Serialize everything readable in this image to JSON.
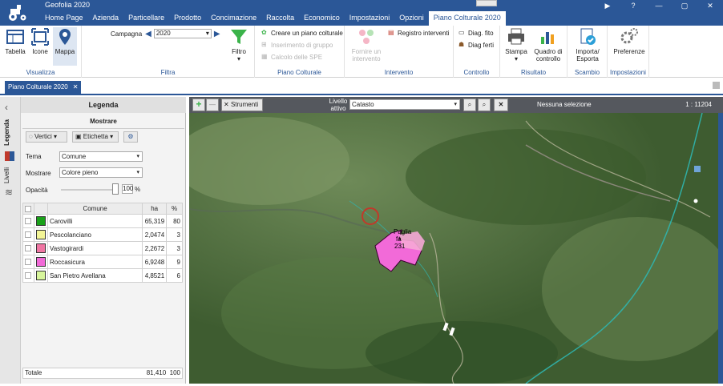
{
  "app": {
    "title": "Geofolia 2020"
  },
  "window": {
    "help": "?",
    "minimize": "—",
    "maximize": "▢",
    "close": "✕",
    "play": "▶"
  },
  "menu": [
    "Home Page",
    "Azienda",
    "Particellare",
    "Prodotto",
    "Concimazione",
    "Raccolta",
    "Economico",
    "Impostazioni",
    "Opzioni",
    "Piano Colturale 2020"
  ],
  "ribbon": {
    "visualizza": {
      "label": "Visualizza",
      "tabella": "Tabella",
      "icone": "Icone",
      "mappa": "Mappa"
    },
    "filtra": {
      "label": "Filtra",
      "campagna_label": "Campagna",
      "campagna_value": "2020",
      "filtro": "Filtro"
    },
    "piano": {
      "label": "Piano Colturale",
      "crea": "Creare un piano colturale",
      "inserimento": "Inserimento di gruppo",
      "calcolo": "Calcolo delle SPE"
    },
    "intervento": {
      "label": "Intervento",
      "fornire": "Fornire un intervento",
      "registro": "Registro interventi"
    },
    "controllo": {
      "label": "Controllo",
      "diag_fito": "Diag. fito",
      "diag_ferti": "Diag ferti"
    },
    "risultato": {
      "label": "Risultato",
      "stampa": "Stampa",
      "quadro": "Quadro di controllo"
    },
    "scambio": {
      "label": "Scambio",
      "importa": "Importa/ Esporta"
    },
    "impostazioni": {
      "label": "Impostazioni",
      "preferenze": "Preferenze"
    }
  },
  "doctab": {
    "label": "Piano Colturale 2020",
    "close": "✕"
  },
  "sidetabs": {
    "legenda": "Legenda",
    "livelli": "Livelli"
  },
  "legend": {
    "title": "Legenda",
    "mostrare_header": "Mostrare",
    "vertici": "Vertici",
    "etichetta": "Etichetta",
    "tema_label": "Tema",
    "tema_value": "Comune",
    "mostrare_label": "Mostrare",
    "mostrare_value": "Colore pieno",
    "opacita_label": "Opacità",
    "opacita_value": "100",
    "opacita_unit": "%",
    "columns": {
      "comune": "Comune",
      "ha": "ha",
      "pct": "%"
    },
    "rows": [
      {
        "name": "Carovilli",
        "ha": "65,319",
        "pct": "80",
        "color": "#1aa11a"
      },
      {
        "name": "Pescolanciano",
        "ha": "2,0474",
        "pct": "3",
        "color": "#f3f596"
      },
      {
        "name": "Vastogirardi",
        "ha": "2,2672",
        "pct": "3",
        "color": "#f076a3"
      },
      {
        "name": "Roccasicura",
        "ha": "6,9248",
        "pct": "9",
        "color": "#f26ad8"
      },
      {
        "name": "San Pietro Avellana",
        "ha": "4,8521",
        "pct": "6",
        "color": "#d7f59b"
      }
    ],
    "total_label": "Totale",
    "total_ha": "81,410",
    "total_pct": "100"
  },
  "map": {
    "strumenti": "Strumenti",
    "livello_label": "Livello attivo",
    "livello_value": "Catasto",
    "selection": "Nessuna selezione",
    "scale": "1 : 11204",
    "parcel_name": "Paglia",
    "parcel_line2": "fa",
    "parcel_id": "231"
  }
}
